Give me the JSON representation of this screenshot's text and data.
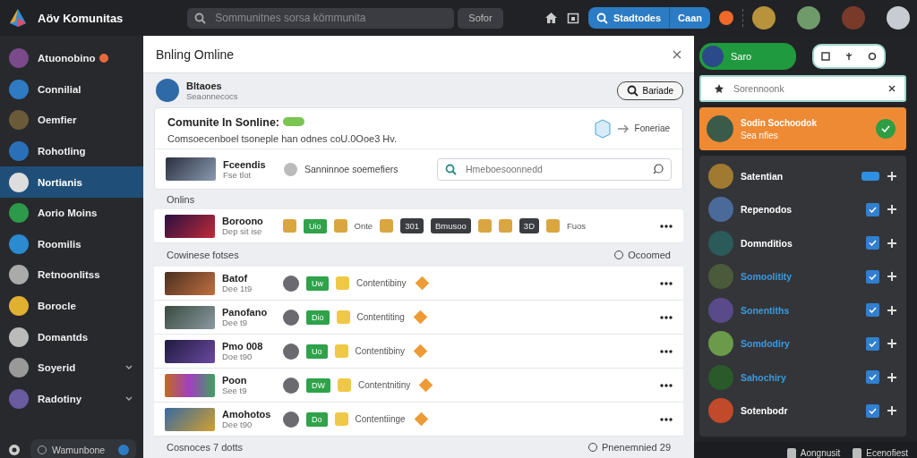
{
  "topbar": {
    "brand": "Aöv Komunitas",
    "search": {
      "placeholder": "Sommunitnes sorsa kömmunita"
    },
    "search_button": "Sofor",
    "action": {
      "label": "Stadtodes",
      "secondary": "Caan"
    }
  },
  "sidebar": {
    "items": [
      {
        "label": "Atuonobino",
        "selected": false,
        "badge": true,
        "expandable": false
      },
      {
        "label": "Connilial",
        "selected": false,
        "badge": false,
        "expandable": false
      },
      {
        "label": "Oemfier",
        "selected": false,
        "badge": false,
        "expandable": false
      },
      {
        "label": "Rohotling",
        "selected": false,
        "badge": false,
        "expandable": false
      },
      {
        "label": "Nortianis",
        "selected": true,
        "badge": false,
        "expandable": false
      },
      {
        "label": "Aorio Moins",
        "selected": false,
        "badge": false,
        "expandable": false
      },
      {
        "label": "Roomilis",
        "selected": false,
        "badge": false,
        "expandable": false
      },
      {
        "label": "Retnoonlitss",
        "selected": false,
        "badge": false,
        "expandable": false
      },
      {
        "label": "Borocle",
        "selected": false,
        "badge": false,
        "expandable": false
      },
      {
        "label": "Domantds",
        "selected": false,
        "badge": false,
        "expandable": false
      },
      {
        "label": "Soyerid",
        "selected": false,
        "badge": false,
        "expandable": true
      },
      {
        "label": "Radotiny",
        "selected": false,
        "badge": false,
        "expandable": true
      }
    ],
    "footer": "Wamunbone"
  },
  "main": {
    "title": "Bnling Omline",
    "user": {
      "name": "Bltaoes",
      "subtitle": "Seaonnecocs"
    },
    "user_button": "Bariade",
    "card": {
      "title": "Comunite In Sonline:",
      "subtitle": "Comsoecenboel tsoneple han odnes coU.0Ooe3 Hv.",
      "link": "Foneriae"
    },
    "feature": {
      "name": "Fceendis",
      "subtitle": "Fse tlot",
      "label": "Sanninnoe soemefiers",
      "search": {
        "placeholder": "Hmeboesoonnedd"
      }
    },
    "online_heading": "Onlins",
    "online_row": {
      "name": "Boroono",
      "subtitle": "Dep sit ise",
      "chips": [
        {
          "kind": "icon"
        },
        {
          "kind": "green",
          "text": "Uio"
        },
        {
          "kind": "icon"
        },
        {
          "kind": "plain",
          "text": "Onte"
        },
        {
          "kind": "icon"
        },
        {
          "kind": "dark",
          "text": "301"
        },
        {
          "kind": "dark",
          "text": "Bmusoo"
        },
        {
          "kind": "icon"
        },
        {
          "kind": "icon"
        },
        {
          "kind": "dark",
          "text": "3D"
        },
        {
          "kind": "icon"
        },
        {
          "kind": "plain",
          "text": "Fuos"
        }
      ]
    },
    "section": {
      "title": "Cowinese fotses",
      "action": "Ocoomed"
    },
    "rows": [
      {
        "name": "Batof",
        "subtitle": "Dee 1t9",
        "tag": "Uw",
        "status": "Contentibiny"
      },
      {
        "name": "Panofano",
        "subtitle": "Dee t9",
        "tag": "Dio",
        "status": "Contentiting"
      },
      {
        "name": "Pmo 008",
        "subtitle": "Doe t90",
        "tag": "Uo",
        "status": "Contentibiny"
      },
      {
        "name": "Poon",
        "subtitle": "See t9",
        "tag": "DW",
        "status": "Contentnitiny"
      },
      {
        "name": "Amohotos",
        "subtitle": "Dee t90",
        "tag": "Do",
        "status": "Contentiinge"
      }
    ],
    "footer": {
      "left": "Cosnoces 7 dotts",
      "right": "Pnenemnied 29"
    }
  },
  "right": {
    "pill": "Saro",
    "search": {
      "placeholder": "Sorennoonk"
    },
    "highlight": {
      "name": "Sodin Sochoodok",
      "subtitle": "Sea nfies"
    },
    "friends": [
      {
        "name": "Satentian",
        "kind": "toggle",
        "checked": true,
        "highlighted": false
      },
      {
        "name": "Repenodos",
        "kind": "checkbox",
        "checked": true,
        "highlighted": false
      },
      {
        "name": "Domnditios",
        "kind": "checkbox",
        "checked": true,
        "highlighted": false
      },
      {
        "name": "Somoolitity",
        "kind": "checkbox",
        "checked": true,
        "highlighted": true
      },
      {
        "name": "Sonentiths",
        "kind": "checkbox",
        "checked": true,
        "highlighted": true
      },
      {
        "name": "Somdodiry",
        "kind": "checkbox",
        "checked": true,
        "highlighted": true
      },
      {
        "name": "Sahochiry",
        "kind": "checkbox",
        "checked": true,
        "highlighted": true
      },
      {
        "name": "Sotenbodr",
        "kind": "checkbox",
        "checked": true,
        "highlighted": false
      }
    ],
    "footer": [
      "Aongnusit",
      "Ecenofiest"
    ]
  }
}
